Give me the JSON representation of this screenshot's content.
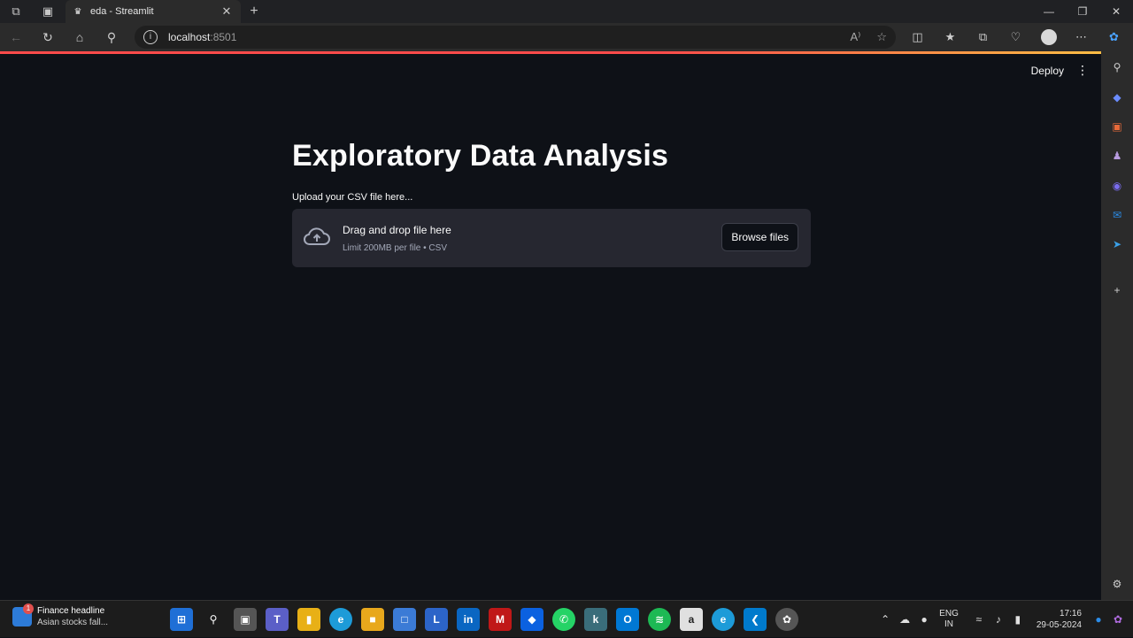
{
  "browser": {
    "tab_title": "eda - Streamlit",
    "url_host": "localhost",
    "url_port": ":8501",
    "read_aloud": "A⁾"
  },
  "app": {
    "deploy_label": "Deploy",
    "title": "Exploratory Data Analysis",
    "uploader": {
      "label": "Upload your CSV file here...",
      "drag_text": "Drag and drop file here",
      "limit_text": "Limit 200MB per file • CSV",
      "browse_label": "Browse files"
    }
  },
  "taskbar": {
    "news_headline": "Finance headline",
    "news_sub": "Asian stocks fall...",
    "news_badge": "1",
    "lang_line1": "ENG",
    "lang_line2": "IN",
    "time": "17:16",
    "date": "29-05-2024"
  },
  "colors": {
    "app_bg": "#0e1117",
    "uploader_bg": "#262730",
    "accent_red": "#ff4b4b"
  }
}
